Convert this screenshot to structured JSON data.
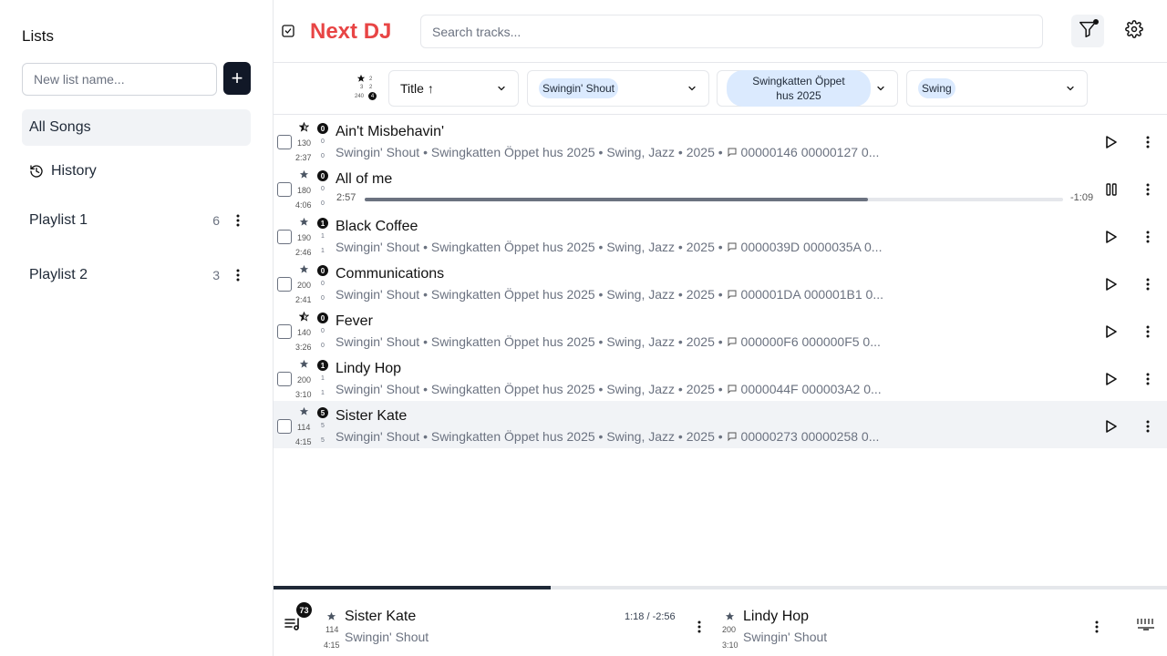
{
  "sidebar": {
    "title": "Lists",
    "new_list_placeholder": "New list name...",
    "add_button_label": "+",
    "items": [
      {
        "label": "All Songs",
        "active": true
      },
      {
        "label": "History",
        "icon": "history-icon"
      },
      {
        "label": "Playlist 1",
        "count": "6"
      },
      {
        "label": "Playlist 2",
        "count": "3"
      }
    ]
  },
  "header": {
    "app_title": "Next DJ",
    "search_placeholder": "Search tracks...",
    "accent_color": "#e84545"
  },
  "filters": {
    "sort_icon_text": {
      "a": "2",
      "b": "3",
      "c": "2",
      "d": "240",
      "e": "4"
    },
    "sort_select": "Title ↑",
    "artist_chip": "Swingin' Shout",
    "album_chip": "Swingkatten Öppet hus 2025",
    "genre_chip": "Swing"
  },
  "tracks": [
    {
      "title": "Ain't Misbehavin'",
      "rating": "0",
      "bpm": "130",
      "duration": "2:37",
      "s1": "0",
      "s2": "0",
      "subtitle": "Swingin' Shout • Swingkatten Öppet hus 2025 • Swing, Jazz • 2025 •",
      "comment": "00000146 00000127 0..."
    },
    {
      "title": "All of me",
      "rating": "0",
      "bpm": "180",
      "duration": "4:06",
      "s1": "0",
      "s2": "0",
      "playing": true,
      "elapsed": "2:57",
      "remaining": "-1:09",
      "progress": 0.72
    },
    {
      "title": "Black Coffee",
      "rating": "1",
      "bpm": "190",
      "duration": "2:46",
      "s1": "1",
      "s2": "1",
      "subtitle": "Swingin' Shout • Swingkatten Öppet hus 2025 • Swing, Jazz • 2025 •",
      "comment": "0000039D 0000035A 0..."
    },
    {
      "title": "Communications",
      "rating": "0",
      "bpm": "200",
      "duration": "2:41",
      "s1": "0",
      "s2": "0",
      "subtitle": "Swingin' Shout • Swingkatten Öppet hus 2025 • Swing, Jazz • 2025 •",
      "comment": "000001DA 000001B1 0..."
    },
    {
      "title": "Fever",
      "rating": "0",
      "bpm": "140",
      "duration": "3:26",
      "s1": "0",
      "s2": "0",
      "subtitle": "Swingin' Shout • Swingkatten Öppet hus 2025 • Swing, Jazz • 2025 •",
      "comment": "000000F6 000000F5 0..."
    },
    {
      "title": "Lindy Hop",
      "rating": "1",
      "bpm": "200",
      "duration": "3:10",
      "s1": "1",
      "s2": "1",
      "subtitle": "Swingin' Shout • Swingkatten Öppet hus 2025 • Swing, Jazz • 2025 •",
      "comment": "0000044F 000003A2 0..."
    },
    {
      "title": "Sister Kate",
      "rating": "5",
      "bpm": "114",
      "duration": "4:15",
      "s1": "5",
      "s2": "5",
      "selected": true,
      "subtitle": "Swingin' Shout • Swingkatten Öppet hus 2025 • Swing, Jazz • 2025 •",
      "comment": "00000273 00000258 0..."
    }
  ],
  "player": {
    "progress": 0.31,
    "queue_count": "73",
    "now": {
      "title": "Sister Kate",
      "artist": "Swingin' Shout",
      "bpm": "114",
      "duration": "4:15",
      "time": "1:18 / -2:56"
    },
    "next": {
      "title": "Lindy Hop",
      "artist": "Swingin' Shout",
      "bpm": "200",
      "duration": "3:10"
    }
  }
}
